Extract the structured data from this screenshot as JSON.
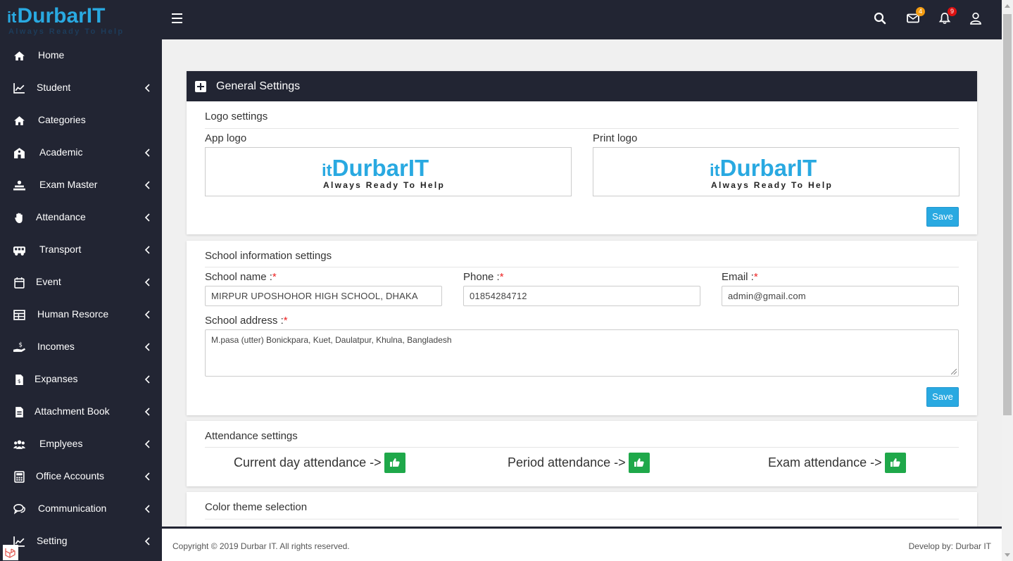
{
  "brand": {
    "logo_prefix": "it",
    "logo_name": "DurbarIT",
    "tagline": "Always Ready To Help"
  },
  "topbar": {
    "mail_badge": "4",
    "bell_badge": "9",
    "colors": {
      "bg": "#222533",
      "mail_badge": "#f39c12",
      "bell_badge": "#dd1111"
    }
  },
  "sidebar": {
    "items": [
      {
        "label": "Home",
        "icon": "home-icon",
        "submenu": false
      },
      {
        "label": "Student",
        "icon": "chart-line-icon",
        "submenu": true
      },
      {
        "label": "Categories",
        "icon": "home-icon",
        "submenu": false
      },
      {
        "label": "Academic",
        "icon": "school-icon",
        "submenu": true
      },
      {
        "label": "Exam Master",
        "icon": "exam-icon",
        "submenu": true
      },
      {
        "label": "Attendance",
        "icon": "hand-icon",
        "submenu": true
      },
      {
        "label": "Transport",
        "icon": "bus-icon",
        "submenu": true
      },
      {
        "label": "Event",
        "icon": "calendar-icon",
        "submenu": true
      },
      {
        "label": "Human Resorce",
        "icon": "table-icon",
        "submenu": true
      },
      {
        "label": "Incomes",
        "icon": "income-icon",
        "submenu": true
      },
      {
        "label": "Expanses",
        "icon": "invoice-icon",
        "submenu": true
      },
      {
        "label": "Attachment Book",
        "icon": "file-icon",
        "submenu": true
      },
      {
        "label": "Emplyees",
        "icon": "users-icon",
        "submenu": true
      },
      {
        "label": "Office Accounts",
        "icon": "calculator-icon",
        "submenu": true
      },
      {
        "label": "Communication",
        "icon": "comments-icon",
        "submenu": true
      },
      {
        "label": "Setting",
        "icon": "chart-line-icon",
        "submenu": true
      }
    ]
  },
  "general_settings": {
    "title": "General Settings",
    "logo_settings": {
      "title": "Logo settings",
      "app_logo_label": "App logo",
      "print_logo_label": "Print logo",
      "save_label": "Save"
    },
    "school_info": {
      "title": "School information settings",
      "school_name_label": "School name :",
      "school_name_value": "MIRPUR UPOSHOHOR HIGH SCHOOL, DHAKA",
      "phone_label": "Phone :",
      "phone_value": "01854284712",
      "email_label": "Email :",
      "email_value": "admin@gmail.com",
      "address_label": "School address :",
      "address_value": "M.pasa (utter) Bonickpara, Kuet, Daulatpur, Khulna, Bangladesh",
      "required_mark": "*",
      "save_label": "Save"
    },
    "attendance": {
      "title": "Attendance settings",
      "current_day": "Current day attendance ->",
      "period": "Period attendance ->",
      "exam": "Exam attendance ->"
    },
    "color_theme": {
      "title": "Color theme selection"
    }
  },
  "footer": {
    "copyright": "Copyright © 2019 Durbar IT. All rights reserved.",
    "developer": "Develop by: Durbar IT"
  }
}
